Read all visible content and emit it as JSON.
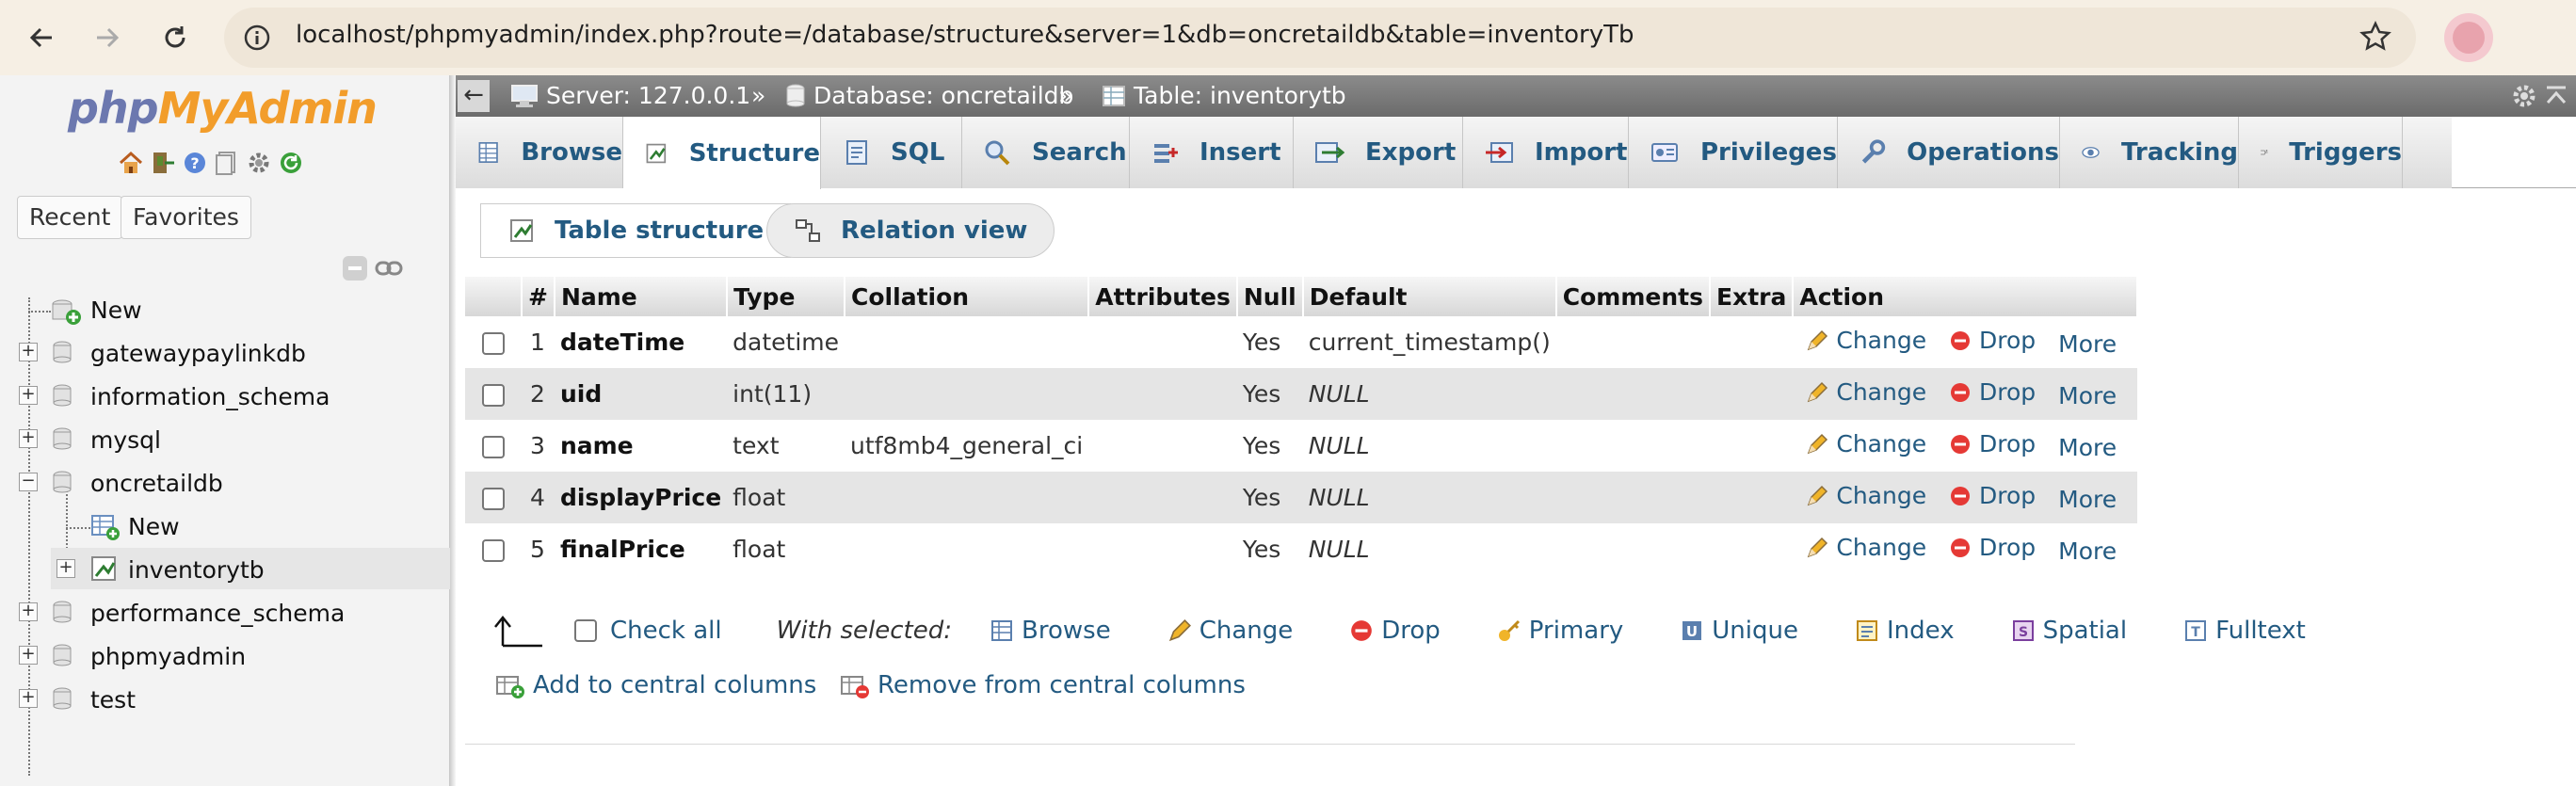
{
  "browser": {
    "url": "localhost/phpmyadmin/index.php?route=/database/structure&server=1&db=oncretaildb&table=inventoryTb"
  },
  "sidebar": {
    "logo_php": "php",
    "logo_myadmin": "MyAdmin",
    "recent_label": "Recent",
    "favorites_label": "Favorites",
    "tree": [
      {
        "label": "New"
      },
      {
        "label": "gatewaypaylinkdb"
      },
      {
        "label": "information_schema"
      },
      {
        "label": "mysql"
      },
      {
        "label": "oncretaildb"
      },
      {
        "label": "New"
      },
      {
        "label": "inventorytb"
      },
      {
        "label": "performance_schema"
      },
      {
        "label": "phpmyadmin"
      },
      {
        "label": "test"
      }
    ]
  },
  "breadcrumb": {
    "server": "Server: 127.0.0.1",
    "database": "Database: oncretaildb",
    "table": "Table: inventorytb",
    "separator": "»"
  },
  "tabs": [
    {
      "label": "Browse",
      "icon": "browse-icon"
    },
    {
      "label": "Structure",
      "icon": "structure-icon"
    },
    {
      "label": "SQL",
      "icon": "sql-icon"
    },
    {
      "label": "Search",
      "icon": "search-icon"
    },
    {
      "label": "Insert",
      "icon": "insert-icon"
    },
    {
      "label": "Export",
      "icon": "export-icon"
    },
    {
      "label": "Import",
      "icon": "import-icon"
    },
    {
      "label": "Privileges",
      "icon": "privileges-icon"
    },
    {
      "label": "Operations",
      "icon": "operations-icon"
    },
    {
      "label": "Tracking",
      "icon": "tracking-icon"
    },
    {
      "label": "Triggers",
      "icon": "triggers-icon"
    }
  ],
  "active_tab": "Structure",
  "subnav": {
    "table_structure": "Table structure",
    "relation_view": "Relation view"
  },
  "table": {
    "headers": [
      "#",
      "Name",
      "Type",
      "Collation",
      "Attributes",
      "Null",
      "Default",
      "Comments",
      "Extra",
      "Action"
    ],
    "rows": [
      {
        "num": "1",
        "name": "dateTime",
        "type": "datetime",
        "collation": "",
        "attributes": "",
        "null": "Yes",
        "default": "current_timestamp()",
        "comments": "",
        "extra": ""
      },
      {
        "num": "2",
        "name": "uid",
        "type": "int(11)",
        "collation": "",
        "attributes": "",
        "null": "Yes",
        "default": "NULL",
        "comments": "",
        "extra": ""
      },
      {
        "num": "3",
        "name": "name",
        "type": "text",
        "collation": "utf8mb4_general_ci",
        "attributes": "",
        "null": "Yes",
        "default": "NULL",
        "comments": "",
        "extra": ""
      },
      {
        "num": "4",
        "name": "displayPrice",
        "type": "float",
        "collation": "",
        "attributes": "",
        "null": "Yes",
        "default": "NULL",
        "comments": "",
        "extra": ""
      },
      {
        "num": "5",
        "name": "finalPrice",
        "type": "float",
        "collation": "",
        "attributes": "",
        "null": "Yes",
        "default": "NULL",
        "comments": "",
        "extra": ""
      }
    ],
    "actions": {
      "change": "Change",
      "drop": "Drop",
      "more": "More"
    }
  },
  "bulk": {
    "check_all": "Check all",
    "with_selected": "With selected:",
    "browse": "Browse",
    "change": "Change",
    "drop": "Drop",
    "primary": "Primary",
    "unique": "Unique",
    "index": "Index",
    "spatial": "Spatial",
    "fulltext": "Fulltext",
    "add_central": "Add to central columns",
    "remove_central": "Remove from central columns"
  },
  "colors": {
    "link": "#235a81",
    "browser_bar": "#f6efe4",
    "server_bar": "#777777",
    "logo_php": "#6c78af",
    "logo_myadmin": "#f29d2b"
  }
}
